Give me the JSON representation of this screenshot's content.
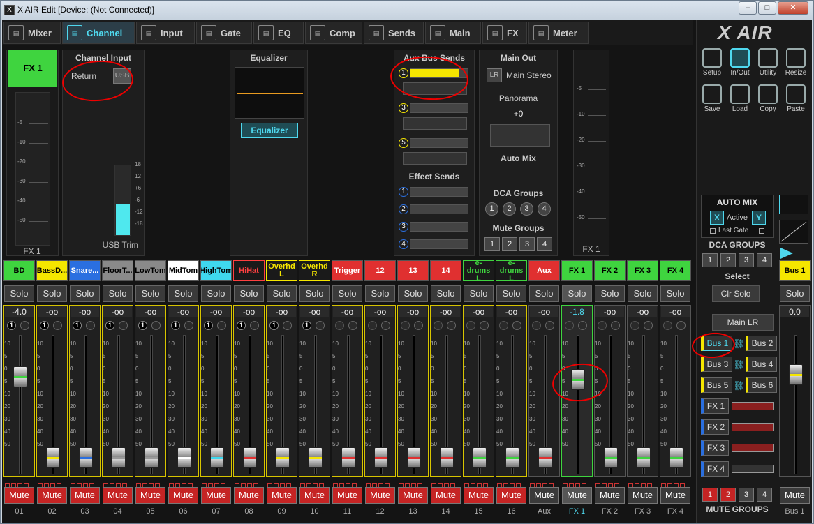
{
  "window": {
    "title": "X AIR Edit [Device: (Not Connected)]",
    "min_label": "–",
    "max_label": "□",
    "close_label": "✕"
  },
  "tabs": [
    {
      "label": "Mixer",
      "icon": "mixer-icon"
    },
    {
      "label": "Channel",
      "icon": "channel-icon"
    },
    {
      "label": "Input",
      "icon": "input-icon"
    },
    {
      "label": "Gate",
      "icon": "gate-icon"
    },
    {
      "label": "EQ",
      "icon": "eq-icon"
    },
    {
      "label": "Comp",
      "icon": "comp-icon"
    },
    {
      "label": "Sends",
      "icon": "sends-icon"
    },
    {
      "label": "Main",
      "icon": "main-icon"
    },
    {
      "label": "FX",
      "icon": "fx-icon"
    },
    {
      "label": "Meter",
      "icon": "meter-icon"
    }
  ],
  "channel_view": {
    "selected_name": "FX 1",
    "meter_label": "FX 1",
    "meter_ticks": [
      "-5",
      "-10",
      "-20",
      "-30",
      "-40",
      "-50"
    ],
    "input": {
      "title": "Channel Input",
      "return_label": "Return",
      "usb_label": "USB",
      "trim_label": "USB Trim",
      "trim_ticks": [
        "18",
        "12",
        "+6",
        "-6",
        "-12",
        "-18"
      ],
      "trim_level": 0.45
    },
    "eq": {
      "title": "Equalizer",
      "button": "Equalizer"
    },
    "aux": {
      "title": "Aux Bus Sends",
      "sends": [
        {
          "num": "1",
          "level": 0.85
        },
        {
          "num": "3",
          "level": 0
        },
        {
          "num": "5",
          "level": 0
        }
      ]
    },
    "effects": {
      "title": "Effect Sends",
      "sends": [
        "1",
        "2",
        "3",
        "4"
      ]
    },
    "main_out": {
      "title": "Main Out",
      "lr_badge": "LR",
      "main_stereo": "Main Stereo",
      "panorama_label": "Panorama",
      "panorama_value": "+0",
      "auto_mix": "Auto Mix"
    },
    "dca": {
      "title": "DCA Groups",
      "items": [
        "1",
        "2",
        "3",
        "4"
      ]
    },
    "mute_groups": {
      "title": "Mute Groups",
      "items": [
        "1",
        "2",
        "3",
        "4"
      ]
    },
    "right_meter_label": "FX 1"
  },
  "fader_ticks": [
    "10",
    "5",
    "0",
    "5",
    "10",
    "20",
    "30",
    "40",
    "50"
  ],
  "solo_label": "Solo",
  "mute_label": "Mute",
  "channels": [
    {
      "name": "BD",
      "num": "01",
      "bg": "#3fd43f",
      "fg": "#000",
      "value": "-4.0",
      "pos": 0.3,
      "color": "#3fd43f",
      "muted": true,
      "yellow": true,
      "c1": "1"
    },
    {
      "name": "BassD...",
      "num": "02",
      "bg": "#f5e600",
      "fg": "#000",
      "value": "-oo",
      "pos": 0.88,
      "color": "#f5e600",
      "muted": true,
      "yellow": true,
      "c1": "1"
    },
    {
      "name": "Snare...",
      "num": "03",
      "bg": "#2a6fe0",
      "fg": "#fff",
      "value": "-oo",
      "pos": 0.88,
      "color": "#2a6fe0",
      "muted": true,
      "yellow": true,
      "c1": "1"
    },
    {
      "name": "FloorT...",
      "num": "04",
      "bg": "#8a8a8a",
      "fg": "#000",
      "value": "-oo",
      "pos": 0.88,
      "color": "#999",
      "muted": true,
      "yellow": true,
      "c1": "1"
    },
    {
      "name": "LowTom",
      "num": "05",
      "bg": "#8a8a8a",
      "fg": "#000",
      "value": "-oo",
      "pos": 0.88,
      "color": "#999",
      "muted": true,
      "yellow": true,
      "c1": "1"
    },
    {
      "name": "MidTom",
      "num": "06",
      "bg": "#ffffff",
      "fg": "#000",
      "value": "-oo",
      "pos": 0.88,
      "color": "#fff",
      "muted": true,
      "yellow": true,
      "c1": "1"
    },
    {
      "name": "HighTom",
      "num": "07",
      "bg": "#3fd8ee",
      "fg": "#000",
      "value": "-oo",
      "pos": 0.88,
      "color": "#3fd8ee",
      "muted": true,
      "yellow": true,
      "c1": "1"
    },
    {
      "name": "HiHat",
      "num": "08",
      "bg": "#1a1a1a",
      "fg": "#ff4040",
      "value": "-oo",
      "pos": 0.88,
      "color": "#e03030",
      "muted": true,
      "yellow": true,
      "c1": "1"
    },
    {
      "name": "Overhd L",
      "num": "09",
      "bg": "#1a1a1a",
      "fg": "#f5e600",
      "value": "-oo",
      "pos": 0.88,
      "color": "#f5e600",
      "muted": true,
      "yellow": true,
      "c1": "1"
    },
    {
      "name": "Overhd R",
      "num": "10",
      "bg": "#1a1a1a",
      "fg": "#f5e600",
      "value": "-oo",
      "pos": 0.88,
      "color": "#f5e600",
      "muted": true,
      "yellow": true,
      "c1": "1"
    },
    {
      "name": "Trigger",
      "num": "11",
      "bg": "#e03030",
      "fg": "#fff",
      "value": "-oo",
      "pos": 0.88,
      "color": "#e03030",
      "muted": true,
      "yellow": true,
      "c1": ""
    },
    {
      "name": "12",
      "num": "12",
      "bg": "#e03030",
      "fg": "#fff",
      "value": "-oo",
      "pos": 0.88,
      "color": "#e03030",
      "muted": true,
      "yellow": true,
      "c1": ""
    },
    {
      "name": "13",
      "num": "13",
      "bg": "#e03030",
      "fg": "#fff",
      "value": "-oo",
      "pos": 0.88,
      "color": "#e03030",
      "muted": true,
      "yellow": true,
      "c1": ""
    },
    {
      "name": "14",
      "num": "14",
      "bg": "#e03030",
      "fg": "#fff",
      "value": "-oo",
      "pos": 0.88,
      "color": "#e03030",
      "muted": true,
      "yellow": true,
      "c1": ""
    },
    {
      "name": "e-drums L",
      "num": "15",
      "bg": "#1a1a1a",
      "fg": "#3fd43f",
      "value": "-oo",
      "pos": 0.88,
      "color": "#3fd43f",
      "muted": true,
      "yellow": true,
      "c1": ""
    },
    {
      "name": "e-drums L",
      "num": "16",
      "bg": "#1a1a1a",
      "fg": "#3fd43f",
      "value": "-oo",
      "pos": 0.88,
      "color": "#3fd43f",
      "muted": true,
      "yellow": true,
      "c1": ""
    },
    {
      "name": "Aux",
      "num": "Aux",
      "bg": "#e03030",
      "fg": "#fff",
      "value": "-oo",
      "pos": 0.88,
      "color": "#e03030",
      "muted": false,
      "yellow": false,
      "c1": ""
    },
    {
      "name": "FX 1",
      "num": "FX 1",
      "bg": "#3fd43f",
      "fg": "#000",
      "value": "-1.8",
      "pos": 0.32,
      "color": "#3fd43f",
      "muted": false,
      "yellow": false,
      "c1": "",
      "selected": true
    },
    {
      "name": "FX 2",
      "num": "FX 2",
      "bg": "#3fd43f",
      "fg": "#000",
      "value": "-oo",
      "pos": 0.88,
      "color": "#3fd43f",
      "muted": false,
      "yellow": false,
      "c1": ""
    },
    {
      "name": "FX 3",
      "num": "FX 3",
      "bg": "#3fd43f",
      "fg": "#000",
      "value": "-oo",
      "pos": 0.88,
      "color": "#3fd43f",
      "muted": false,
      "yellow": false,
      "c1": ""
    },
    {
      "name": "FX 4",
      "num": "FX 4",
      "bg": "#3fd43f",
      "fg": "#000",
      "value": "-oo",
      "pos": 0.88,
      "color": "#3fd43f",
      "muted": false,
      "yellow": false,
      "c1": ""
    }
  ],
  "right_panel": {
    "logo": "X AIR",
    "tools": [
      {
        "label": "Setup",
        "icon": "gear-icon"
      },
      {
        "label": "In/Out",
        "icon": "in-out-icon",
        "active": true
      },
      {
        "label": "Utility",
        "icon": "wrench-icon"
      },
      {
        "label": "Resize",
        "icon": "resize-icon"
      },
      {
        "label": "Save",
        "icon": "save-icon"
      },
      {
        "label": "Load",
        "icon": "folder-icon"
      },
      {
        "label": "Copy",
        "icon": "copy-icon"
      },
      {
        "label": "Paste",
        "icon": "paste-icon"
      }
    ],
    "automix": {
      "title": "AUTO MIX",
      "x": "X",
      "active": "Active",
      "y": "Y",
      "last_gate": "Last Gate"
    },
    "dca_groups": {
      "title": "DCA GROUPS",
      "items": [
        "1",
        "2",
        "3",
        "4"
      ]
    },
    "select_label": "Select",
    "clr_solo": "Clr Solo",
    "main_lr": "Main LR",
    "buses": [
      "Bus 1",
      "Bus 2",
      "Bus 3",
      "Bus 4",
      "Bus 5",
      "Bus 6"
    ],
    "fx": [
      "FX 1",
      "FX 2",
      "FX 3",
      "FX 4"
    ],
    "mute_groups": {
      "title": "MUTE GROUPS",
      "items": [
        "1",
        "2",
        "3",
        "4"
      ]
    },
    "bus_strip": {
      "name": "Bus 1",
      "solo": "Solo",
      "value": "0.0",
      "mute": "Mute",
      "num": "Bus 1"
    }
  }
}
